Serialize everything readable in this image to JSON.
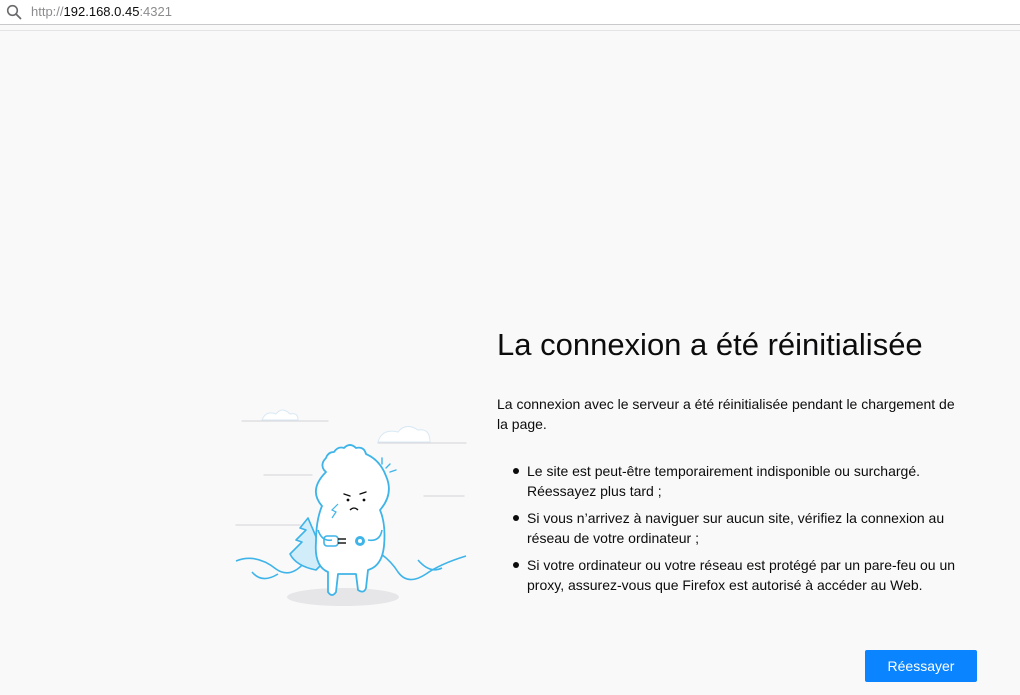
{
  "urlbar": {
    "scheme": "http://",
    "host": "192.168.0.45",
    "port": ":4321",
    "search_icon": "search-icon"
  },
  "error_page": {
    "title": "La connexion a été réinitialisée",
    "description": "La connexion avec le serveur a été réinitialisée pendant le chargement de la page.",
    "bullets": [
      "Le site est peut-être temporairement indisponible ou surchargé. Réessayez plus tard ;",
      "Si vous n’arrivez à naviguer sur aucun site, vérifiez la connexion au réseau de votre ordinateur ;",
      "Si votre ordinateur ou votre réseau est protégé par un pare-feu ou un proxy, assurez-vous que Firefox est autorisé à accéder au Web."
    ],
    "retry_label": "Réessayer",
    "illustration_icon": "disconnected-dino-illustration"
  },
  "colors": {
    "accent": "#0a84ff",
    "background": "#f9f9fa",
    "illustration": "#3fb4e8"
  }
}
